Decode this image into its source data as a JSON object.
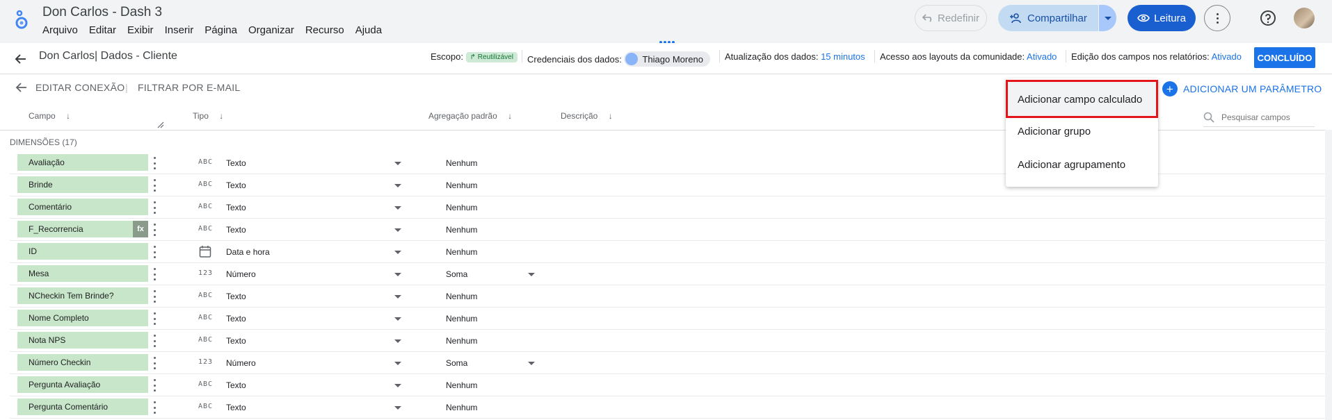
{
  "app": {
    "title": "Don Carlos - Dash 3",
    "menu": [
      "Arquivo",
      "Editar",
      "Exibir",
      "Inserir",
      "Página",
      "Organizar",
      "Recurso",
      "Ajuda"
    ],
    "redefinir_label": "Redefinir",
    "share_label": "Compartilhar",
    "read_label": "Leitura"
  },
  "subbar": {
    "title": "Don Carlos| Dados - Cliente",
    "scope_label": "Escopo:",
    "scope_chip": "Reutilizável",
    "credentials_label": "Credenciais dos dados:",
    "credentials_user": "Thiago Moreno",
    "refresh_label": "Atualização dos dados:",
    "refresh_value": "15 minutos",
    "community_label": "Acesso aos layouts da comunidade:",
    "community_value": "Ativado",
    "edit_label": "Edição dos campos nos relatórios:",
    "edit_value": "Ativado",
    "done_label": "CONCLUÍDO"
  },
  "toolbar": {
    "edit_connection": "EDITAR CONEXÃO",
    "separator": "|",
    "filter_email": "FILTRAR POR E-MAIL",
    "add_parameter": "ADICIONAR UM PARÂMETRO"
  },
  "columns": {
    "campo": "Campo",
    "tipo": "Tipo",
    "agregacao": "Agregação padrão",
    "descricao": "Descrição"
  },
  "search": {
    "placeholder": "Pesquisar campos"
  },
  "section": {
    "title": "DIMENSÕES (17)"
  },
  "rows": [
    {
      "field": "Avaliação",
      "type_icon": "ABC",
      "type": "Texto",
      "agg": "Nenhum",
      "fx": ""
    },
    {
      "field": "Brinde",
      "type_icon": "ABC",
      "type": "Texto",
      "agg": "Nenhum",
      "fx": ""
    },
    {
      "field": "Comentário",
      "type_icon": "ABC",
      "type": "Texto",
      "agg": "Nenhum",
      "fx": ""
    },
    {
      "field": "F_Recorrencia",
      "type_icon": "ABC",
      "type": "Texto",
      "agg": "Nenhum",
      "fx": "fx"
    },
    {
      "field": "ID",
      "type_icon": "calendar-icon",
      "type": "Data e hora",
      "agg": "Nenhum",
      "fx": ""
    },
    {
      "field": "Mesa",
      "type_icon": "123",
      "type": "Número",
      "agg": "Soma",
      "fx": ""
    },
    {
      "field": "NCheckin Tem Brinde?",
      "type_icon": "ABC",
      "type": "Texto",
      "agg": "Nenhum",
      "fx": ""
    },
    {
      "field": "Nome Completo",
      "type_icon": "ABC",
      "type": "Texto",
      "agg": "Nenhum",
      "fx": ""
    },
    {
      "field": "Nota NPS",
      "type_icon": "ABC",
      "type": "Texto",
      "agg": "Nenhum",
      "fx": ""
    },
    {
      "field": "Número Checkin",
      "type_icon": "123",
      "type": "Número",
      "agg": "Soma",
      "fx": ""
    },
    {
      "field": "Pergunta Avaliação",
      "type_icon": "ABC",
      "type": "Texto",
      "agg": "Nenhum",
      "fx": ""
    },
    {
      "field": "Pergunta Comentário",
      "type_icon": "ABC",
      "type": "Texto",
      "agg": "Nenhum",
      "fx": ""
    }
  ],
  "dropdown": {
    "items": [
      "Adicionar campo calculado",
      "Adicionar grupo",
      "Adicionar agrupamento"
    ],
    "highlight_color": "#e4141b"
  },
  "colors": {
    "accent": "#1a73e8",
    "field_bg": "#c8e6c9"
  }
}
